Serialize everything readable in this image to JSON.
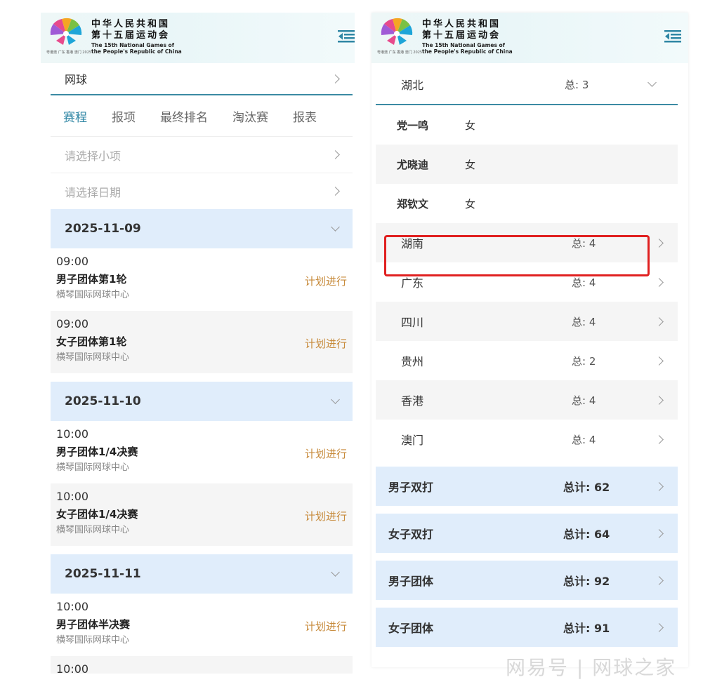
{
  "header": {
    "title_cn_line1": "中华人民共和国",
    "title_cn_line2": "第十五届运动会",
    "title_en_line1": "The 15th National Games of",
    "title_en_line2": "the People's Republic of China",
    "logo_caption": "粤港澳 广东 香港 澳门 2025"
  },
  "left": {
    "sport": "网球",
    "tabs": [
      "赛程",
      "报项",
      "最终排名",
      "淘汰赛",
      "报表"
    ],
    "select_event_placeholder": "请选择小项",
    "select_date_placeholder": "请选择日期",
    "days": [
      {
        "date": "2025-11-09",
        "events": [
          {
            "time": "09:00",
            "name": "男子团体第1轮",
            "venue": "横琴国际网球中心",
            "status": "计划进行"
          },
          {
            "time": "09:00",
            "name": "女子团体第1轮",
            "venue": "横琴国际网球中心",
            "status": "计划进行"
          }
        ]
      },
      {
        "date": "2025-11-10",
        "events": [
          {
            "time": "10:00",
            "name": "男子团体1/4决赛",
            "venue": "横琴国际网球中心",
            "status": "计划进行"
          },
          {
            "time": "10:00",
            "name": "女子团体1/4决赛",
            "venue": "横琴国际网球中心",
            "status": "计划进行"
          }
        ]
      },
      {
        "date": "2025-11-11",
        "events": [
          {
            "time": "10:00",
            "name": "男子团体半决赛",
            "venue": "横琴国际网球中心",
            "status": "计划进行"
          },
          {
            "time": "10:00"
          }
        ]
      }
    ]
  },
  "right": {
    "expanded_province": {
      "name": "湖北",
      "count_label": "总:",
      "count": "3"
    },
    "players": [
      {
        "name": "党一鸣",
        "gender": "女"
      },
      {
        "name": "尤晓迪",
        "gender": "女"
      },
      {
        "name": "郑钦文",
        "gender": "女"
      }
    ],
    "provinces": [
      {
        "name": "湖南",
        "count": "4"
      },
      {
        "name": "广东",
        "count": "4"
      },
      {
        "name": "四川",
        "count": "4"
      },
      {
        "name": "贵州",
        "count": "2"
      },
      {
        "name": "香港",
        "count": "4"
      },
      {
        "name": "澳门",
        "count": "4"
      }
    ],
    "province_count_label": "总:",
    "category_total_label": "总计:",
    "categories": [
      {
        "name": "男子双打",
        "total": "62"
      },
      {
        "name": "女子双打",
        "total": "64"
      },
      {
        "name": "男子团体",
        "total": "92"
      },
      {
        "name": "女子团体",
        "total": "91"
      }
    ]
  },
  "watermark": "网易号 | 网球之家",
  "colors": {
    "accent": "#2f86a4",
    "status_planned": "#c78a3a",
    "section_bg": "#e0edfb",
    "highlight_box": "#e02020"
  }
}
